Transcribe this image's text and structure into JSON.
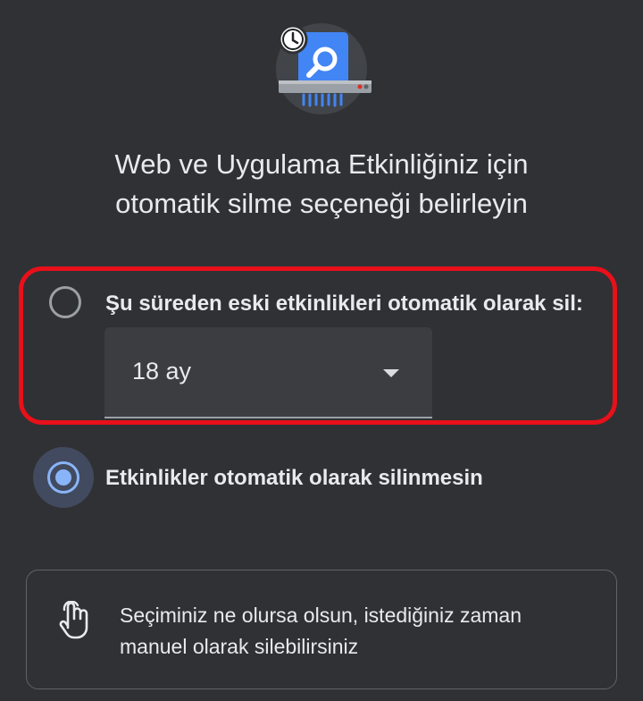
{
  "header": {
    "illustration": "activity-shredder-icon",
    "title_line1": "Web ve Uygulama Etkinliğiniz için",
    "title_line2": "otomatik silme seçeneği belirleyin"
  },
  "options": {
    "auto_delete": {
      "label": "Şu süreden eski etkinlikleri otomatik olarak sil:",
      "selected": false,
      "dropdown_value": "18 ay"
    },
    "no_auto_delete": {
      "label": "Etkinlikler otomatik olarak silinmesin",
      "selected": true
    }
  },
  "info": {
    "icon": "hand-touch-icon",
    "line1": "Seçiminiz ne olursa olsun, istediğiniz zaman",
    "line2": "manuel olarak silebilirsiniz"
  },
  "colors": {
    "background": "#303134",
    "highlight": "#e8101a",
    "accent": "#8ab4f8"
  }
}
